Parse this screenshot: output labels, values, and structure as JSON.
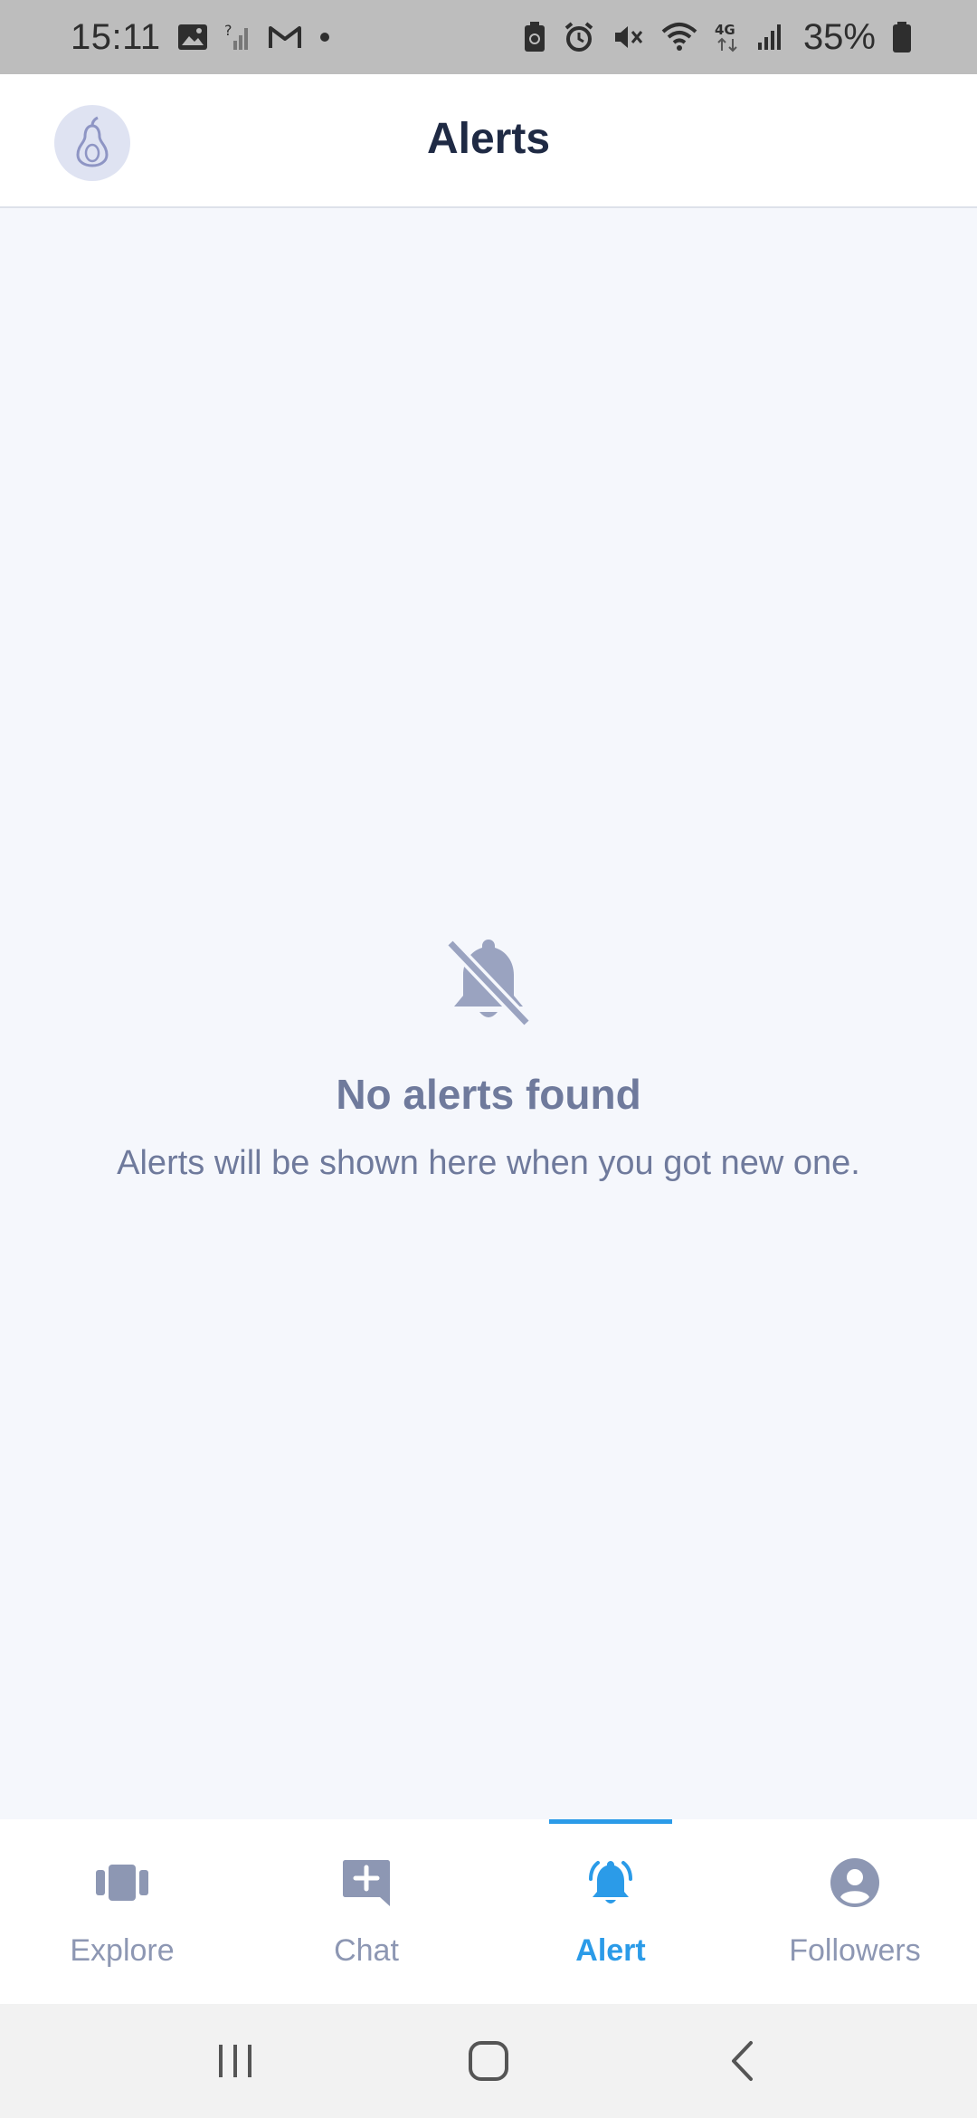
{
  "status_bar": {
    "time": "15:11",
    "battery_percent": "35%",
    "left_icons": [
      "image-icon",
      "signal-unknown-icon",
      "gmail-icon",
      "dot-icon"
    ],
    "right_icons": [
      "battery-saver-icon",
      "alarm-icon",
      "mute-icon",
      "wifi-icon",
      "4g-icon",
      "signal-icon",
      "battery-icon"
    ]
  },
  "header": {
    "title": "Alerts",
    "avatar_icon": "pear-logo-icon"
  },
  "empty_state": {
    "icon": "bell-off-icon",
    "title": "No alerts found",
    "subtitle": "Alerts will be shown here when you got new one."
  },
  "bottom_nav": {
    "active": "Alert",
    "items": [
      {
        "label": "Explore",
        "icon": "explore-cards-icon"
      },
      {
        "label": "Chat",
        "icon": "chat-add-icon"
      },
      {
        "label": "Alert",
        "icon": "bell-ringing-icon"
      },
      {
        "label": "Followers",
        "icon": "user-circle-icon"
      }
    ]
  },
  "colors": {
    "accent": "#2b9be8",
    "inactive": "#8d97b3",
    "title": "#1f2a44",
    "muted_text": "#6f7a9c",
    "background": "#f5f7fc"
  }
}
